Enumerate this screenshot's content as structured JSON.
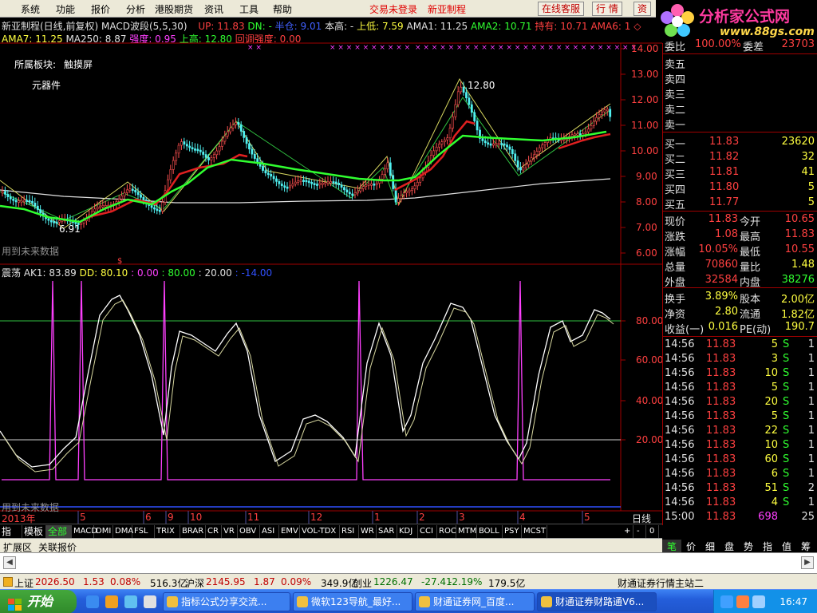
{
  "menu": [
    "系统",
    "功能",
    "报价",
    "分析",
    "港股期货",
    "资讯",
    "工具",
    "帮助"
  ],
  "menu_right": {
    "login_status": "交易未登录",
    "stock": "新亚制程",
    "buttons": [
      "在线客服",
      "行 情",
      "资"
    ]
  },
  "logo": {
    "title": "分析家公式网",
    "url": "www.88gs.com"
  },
  "info_line1": {
    "title": "新亚制程(日线,前复权)",
    "indicator": "MACD波段(5,5,30)",
    "up": "UP: 11.83",
    "dn": "DN: -",
    "half": "半仓: 9.01",
    "this_high": "本高: -",
    "up_low": "上低: 7.59",
    "ama1": "AMA1: 11.25",
    "ama2": "AMA2: 10.71",
    "hold": "持有: 10.71",
    "ama6": "AMA6: 1",
    "diamond": "◇"
  },
  "info_line2": {
    "ama7": "AMA7: 11.25",
    "ma250": "MA250: 8.87",
    "strength": "强度: 0.95",
    "up_high": "上高: 12.80",
    "pullback": "回调强度: 0.00"
  },
  "sector_label": "所属板块:",
  "sector_value": "触摸屏",
  "sector_sub": "元器件",
  "future_data_note": "用到未来数据",
  "top_axis_ticks": [
    "14.00",
    "13.00",
    "12.00",
    "11.00",
    "10.00",
    "9.00",
    "8.00",
    "7.00",
    "6.00"
  ],
  "price_annotations": {
    "high": "12.80",
    "low": "6.91"
  },
  "lower_indicator": {
    "name": "震荡",
    "ak1": "AK1: 83.89",
    "dd": "DD: 80.10",
    "v0": ": 0.00",
    "v80": ": 80.00",
    "v20": ": 20.00",
    "vneg": ": -14.00"
  },
  "lower_axis_ticks": [
    "80.00",
    "60.00",
    "40.00",
    "20.00"
  ],
  "time_labels": [
    "2013年",
    "5",
    "6",
    "9",
    "10",
    "11",
    "12",
    "1",
    "2",
    "3",
    "4",
    "5"
  ],
  "timeaxis_right": "日线",
  "tabs": [
    "指标",
    "模板",
    "全部",
    "MACD",
    "DMI",
    "DMA",
    "FSL",
    "TRIX",
    "BRAR",
    "CR",
    "VR",
    "OBV",
    "ASI",
    "EMV",
    "VOL-TDX",
    "RSI",
    "WR",
    "SAR",
    "KDJ",
    "CCI",
    "ROC",
    "MTM",
    "BOLL",
    "PSY",
    "MCST"
  ],
  "tabs_right": [
    "+",
    "-",
    "0"
  ],
  "ext_tabs": [
    "扩展区",
    "关联报价"
  ],
  "panel": {
    "partial_top": {
      "label_left": "委比",
      "value_left": "100.00%",
      "label_right": "委差",
      "value_right": "23703"
    },
    "sell": [
      {
        "label": "卖五"
      },
      {
        "label": "卖四"
      },
      {
        "label": "卖三"
      },
      {
        "label": "卖二"
      },
      {
        "label": "卖一"
      }
    ],
    "buy": [
      {
        "label": "买一",
        "price": "11.83",
        "vol": "23620"
      },
      {
        "label": "买二",
        "price": "11.82",
        "vol": "32"
      },
      {
        "label": "买三",
        "price": "11.81",
        "vol": "41"
      },
      {
        "label": "买四",
        "price": "11.80",
        "vol": "5"
      },
      {
        "label": "买五",
        "price": "11.77",
        "vol": "5"
      }
    ],
    "stats1": [
      {
        "l1": "现价",
        "v1": "11.83",
        "l2": "今开",
        "v2": "10.65"
      },
      {
        "l1": "涨跌",
        "v1": "1.08",
        "l2": "最高",
        "v2": "11.83"
      },
      {
        "l1": "涨幅",
        "v1": "10.05%",
        "l2": "最低",
        "v2": "10.55"
      },
      {
        "l1": "总量",
        "v1": "70860",
        "l2": "量比",
        "v2": "1.48"
      },
      {
        "l1": "外盘",
        "v1": "32584",
        "l2": "内盘",
        "v2": "38276"
      }
    ],
    "stats2": [
      {
        "l1": "换手",
        "v1": "3.89%",
        "l2": "股本",
        "v2": "2.00亿"
      },
      {
        "l1": "净资",
        "v1": "2.80",
        "l2": "流通",
        "v2": "1.82亿"
      },
      {
        "l1": "收益(一)",
        "v1": "0.016",
        "l2": "PE(动)",
        "v2": "190.7"
      }
    ],
    "ticks": [
      {
        "t": "14:56",
        "p": "11.83",
        "v": "5",
        "s": "S",
        "n": "1"
      },
      {
        "t": "14:56",
        "p": "11.83",
        "v": "3",
        "s": "S",
        "n": "1"
      },
      {
        "t": "14:56",
        "p": "11.83",
        "v": "10",
        "s": "S",
        "n": "1"
      },
      {
        "t": "14:56",
        "p": "11.83",
        "v": "5",
        "s": "S",
        "n": "1"
      },
      {
        "t": "14:56",
        "p": "11.83",
        "v": "20",
        "s": "S",
        "n": "1"
      },
      {
        "t": "14:56",
        "p": "11.83",
        "v": "5",
        "s": "S",
        "n": "1"
      },
      {
        "t": "14:56",
        "p": "11.83",
        "v": "22",
        "s": "S",
        "n": "1"
      },
      {
        "t": "14:56",
        "p": "11.83",
        "v": "10",
        "s": "S",
        "n": "1"
      },
      {
        "t": "14:56",
        "p": "11.83",
        "v": "60",
        "s": "S",
        "n": "1"
      },
      {
        "t": "14:56",
        "p": "11.83",
        "v": "6",
        "s": "S",
        "n": "1"
      },
      {
        "t": "14:56",
        "p": "11.83",
        "v": "51",
        "s": "S",
        "n": "2"
      },
      {
        "t": "14:56",
        "p": "11.83",
        "v": "4",
        "s": "S",
        "n": "1"
      },
      {
        "t": "15:00",
        "p": "11.83",
        "v": "698",
        "s": "",
        "n": "25"
      }
    ],
    "bottom_tabs": [
      "笔",
      "价",
      "细",
      "盘",
      "势",
      "指",
      "值",
      "筹"
    ]
  },
  "status": [
    {
      "label": "上证",
      "value": "2026.50",
      "chg": "1.53",
      "pct": "0.08%",
      "amt": "516.3亿"
    },
    {
      "label": "沪深",
      "value": "2145.95",
      "chg": "1.87",
      "pct": "0.09%",
      "amt": "349.9亿"
    },
    {
      "label": "创业",
      "value": "1226.47",
      "chg": "-27.41",
      "pct": "-2.19%",
      "amt": "179.5亿"
    }
  ],
  "status_right": "财通证券行情主站二",
  "taskbar": {
    "start": "开始",
    "tasks": [
      "指标公式分享交流...",
      "微软123导航_最好...",
      "财通证券网_百度...",
      "财通证券财路通V6..."
    ],
    "clock": "16:47"
  },
  "colors": {
    "up": "#ff4040",
    "down": "#30ff30",
    "accent": "#ffff40",
    "signal": "#ff40ff"
  }
}
